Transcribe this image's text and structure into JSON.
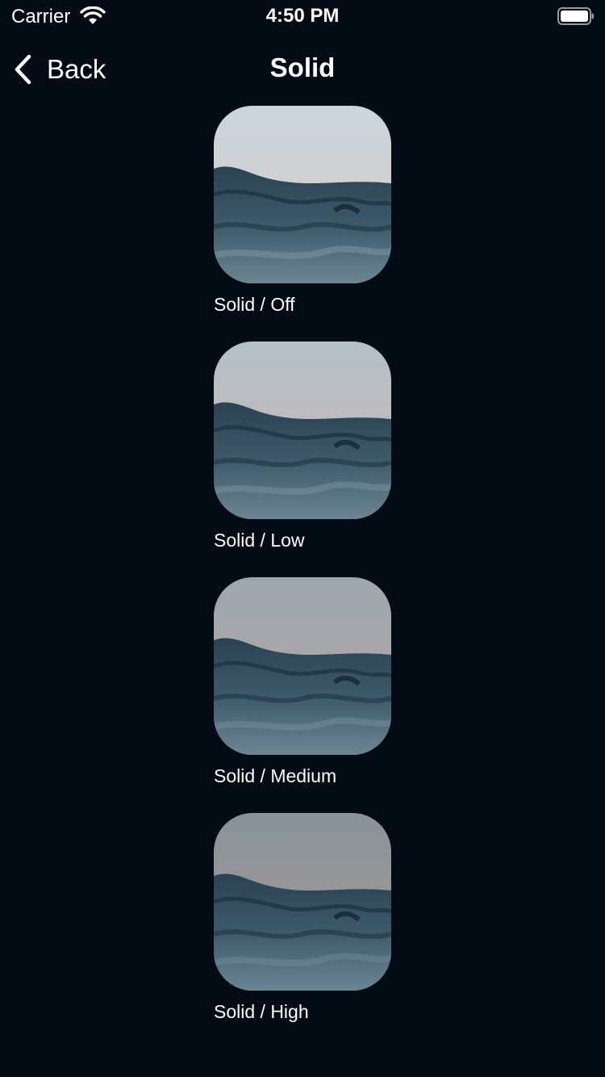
{
  "status_bar": {
    "carrier": "Carrier",
    "time": "4:50 PM",
    "icons": [
      "wifi-icon",
      "battery-icon"
    ]
  },
  "nav": {
    "back_label": "Back",
    "back_icon": "chevron-left-icon",
    "title": "Solid"
  },
  "items": [
    {
      "label": "Solid / Off",
      "image": "ocean-waves-photo",
      "sky_top": "#c9d6dd",
      "sky_horizon": "#d9c7c4"
    },
    {
      "label": "Solid / Low",
      "image": "ocean-waves-photo",
      "sky_top": "#b3c0c8",
      "sky_horizon": "#cdb6b3"
    },
    {
      "label": "Solid / Medium",
      "image": "ocean-waves-photo",
      "sky_top": "#9aa7af",
      "sky_horizon": "#bea7a4"
    },
    {
      "label": "Solid / High",
      "image": "ocean-waves-photo",
      "sky_top": "#86939b",
      "sky_horizon": "#ae9894"
    }
  ],
  "colors": {
    "background": "#020a14",
    "text": "#ffffff",
    "water_dark": "#1f3442",
    "water_mid": "#3d5a6b"
  }
}
